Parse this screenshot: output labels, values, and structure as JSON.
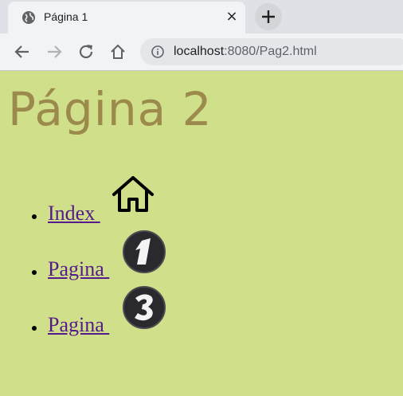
{
  "browser": {
    "tab_title": "Página 1",
    "tab_close": "×",
    "url_host": "localhost",
    "url_rest": ":8080/Pag2.html"
  },
  "page": {
    "heading": "Página 2",
    "links": [
      {
        "label": "Index ",
        "icon": "house-icon"
      },
      {
        "label": "Pagina ",
        "icon": "number-1-icon"
      },
      {
        "label": "Pagina ",
        "icon": "number-3-icon"
      }
    ]
  },
  "colors": {
    "page_bg": "#cfdf8a",
    "heading": "#9b8a4b",
    "link": "#551a8b"
  }
}
